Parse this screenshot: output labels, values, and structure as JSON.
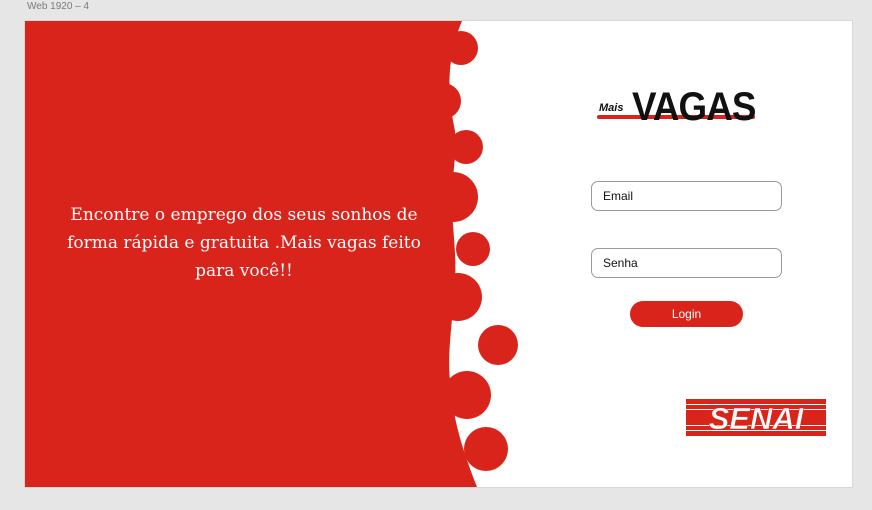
{
  "frame": {
    "label": "Web 1920 – 4"
  },
  "hero": {
    "tagline": "Encontre o emprego dos seus sonhos de forma rápida e gratuita .Mais vagas feito para você!!"
  },
  "logo": {
    "small_text": "Mais",
    "main_text": "VAGAS"
  },
  "form": {
    "email_placeholder": "Email",
    "password_placeholder": "Senha",
    "login_label": "Login"
  },
  "footer_logo": {
    "text": "SENAI"
  },
  "colors": {
    "brand_red": "#d9241c",
    "background": "#ffffff",
    "canvas": "#e6e6e6"
  }
}
